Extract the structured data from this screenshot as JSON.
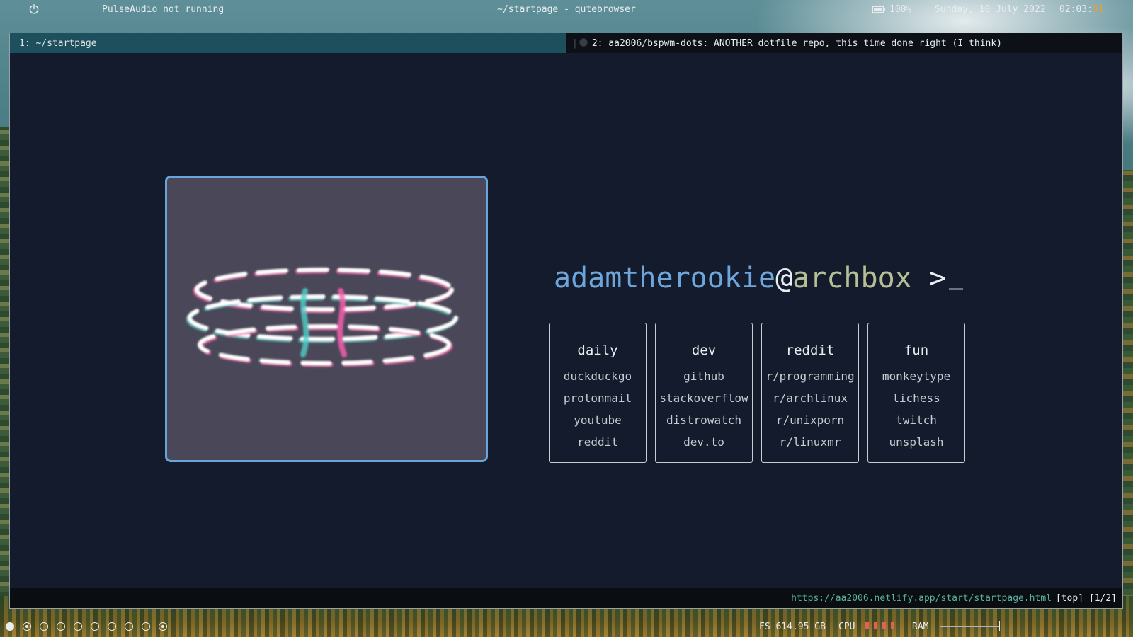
{
  "topbar": {
    "power_icon": "power-icon",
    "pulse_status": "PulseAudio not running",
    "window_title": "~/startpage - qutebrowser",
    "battery_icon": "battery-icon",
    "battery_pct": "100%",
    "date": "Sunday, 10 July 2022",
    "time_hm": "02:03:",
    "time_s": "51",
    "seconds_color": "#e8a030"
  },
  "tabs": [
    {
      "label": "1: ~/startpage",
      "active": true
    },
    {
      "label": "2: aa2006/bspwm-dots: ANOTHER dotfile repo, this time done right (I think)",
      "active": false,
      "icon": "github-icon"
    }
  ],
  "prompt": {
    "user": "adamtherookie",
    "at": "@",
    "host": "archbox",
    "symbol": ">",
    "user_color": "#6ea6dc",
    "host_color": "#b6bf95"
  },
  "cards": [
    {
      "title": "daily",
      "links": [
        "duckduckgo",
        "protonmail",
        "youtube",
        "reddit"
      ]
    },
    {
      "title": "dev",
      "links": [
        "github",
        "stackoverflow",
        "distrowatch",
        "dev.to"
      ]
    },
    {
      "title": "reddit",
      "links": [
        "r/programming",
        "r/archlinux",
        "r/unixporn",
        "r/linuxmr"
      ]
    },
    {
      "title": "fun",
      "links": [
        "monkeytype",
        "lichess",
        "twitch",
        "unsplash"
      ]
    }
  ],
  "statusbar": {
    "url": "https://aa2006.netlify.app/start/startpage.html",
    "position": "[top] [1/2]"
  },
  "bottombar": {
    "workspaces": [
      "filled",
      "dot",
      "empty",
      "empty",
      "empty",
      "empty",
      "empty",
      "empty",
      "empty",
      "dot"
    ],
    "fs": "FS 614.95 GB",
    "cpu_label": "CPU",
    "ram_label": "RAM",
    "cpu_bar_color": "#e06060"
  },
  "colors": {
    "accent": "#69a4dc",
    "background": "#131b2c",
    "tab_active": "#1d4f5c",
    "url": "#5ab1a0"
  }
}
